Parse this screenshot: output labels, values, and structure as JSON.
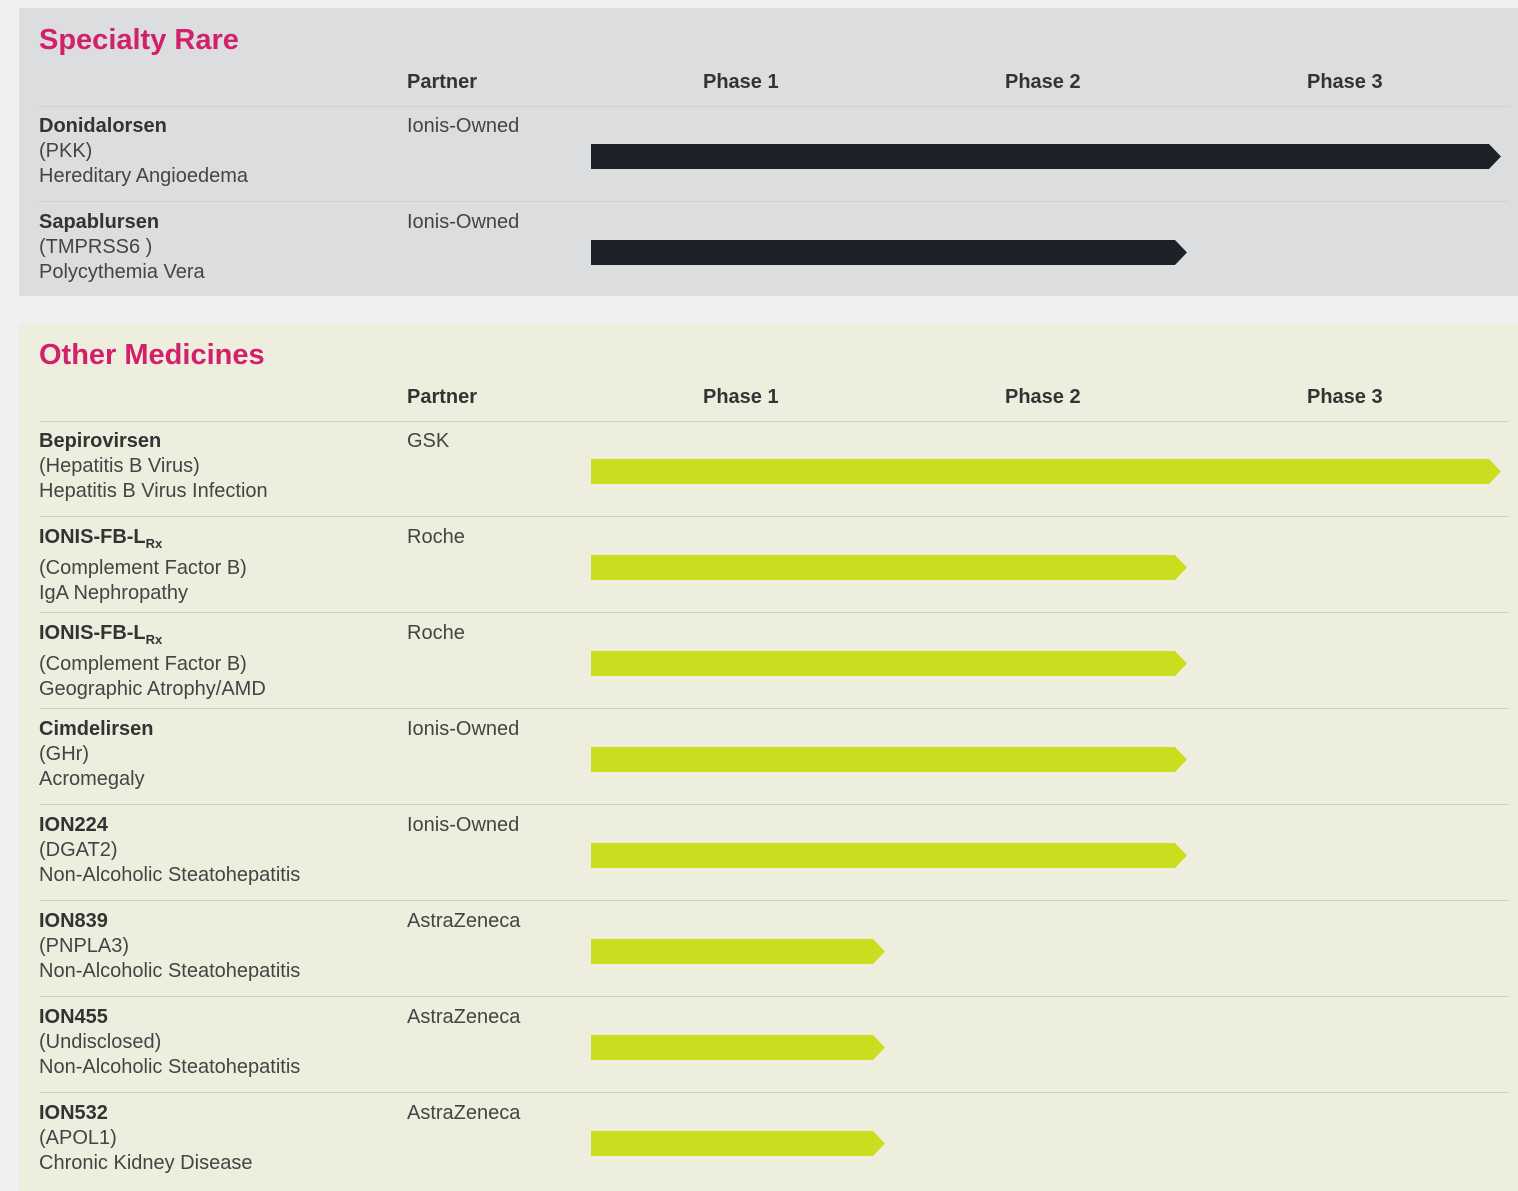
{
  "colors": {
    "title": "#d2206b",
    "rare_bar": "#1d2128",
    "other_bar": "#ccdc1f",
    "rare_bg": "#dcdddf",
    "other_bg": "#eeeedf"
  },
  "headers": {
    "partner": "Partner",
    "phase1": "Phase 1",
    "phase2": "Phase 2",
    "phase3": "Phase 3"
  },
  "specialty_rare": {
    "title": "Specialty Rare",
    "rows": [
      {
        "name": "Donidalorsen",
        "name_sub": "",
        "target": "(PKK)",
        "indication": "Hereditary Angioedema",
        "partner": "Ionis-Owned",
        "phase_reached": 3
      },
      {
        "name": "Sapablursen",
        "name_sub": "",
        "target": "(TMPRSS6 )",
        "indication": "Polycythemia Vera",
        "partner": "Ionis-Owned",
        "phase_reached": 2
      }
    ]
  },
  "other_medicines": {
    "title": "Other Medicines",
    "rows": [
      {
        "name": "Bepirovirsen",
        "name_sub": "",
        "target": "(Hepatitis B Virus)",
        "indication": "Hepatitis B Virus Infection",
        "partner": "GSK",
        "phase_reached": 3
      },
      {
        "name": "IONIS-FB-L",
        "name_sub": "Rx",
        "target": "(Complement Factor B)",
        "indication": "IgA Nephropathy",
        "partner": "Roche",
        "phase_reached": 2
      },
      {
        "name": "IONIS-FB-L",
        "name_sub": "Rx",
        "target": "(Complement Factor B)",
        "indication": "Geographic Atrophy/AMD",
        "partner": "Roche",
        "phase_reached": 2
      },
      {
        "name": "Cimdelirsen",
        "name_sub": "",
        "target": "(GHr)",
        "indication": "Acromegaly",
        "partner": "Ionis-Owned",
        "phase_reached": 2
      },
      {
        "name": "ION224",
        "name_sub": "",
        "target": "(DGAT2)",
        "indication": "Non-Alcoholic Steatohepatitis",
        "partner": "Ionis-Owned",
        "phase_reached": 2
      },
      {
        "name": "ION839",
        "name_sub": "",
        "target": "(PNPLA3)",
        "indication": "Non-Alcoholic Steatohepatitis",
        "partner": "AstraZeneca",
        "phase_reached": 1
      },
      {
        "name": "ION455",
        "name_sub": "",
        "target": "(Undisclosed)",
        "indication": "Non-Alcoholic Steatohepatitis",
        "partner": "AstraZeneca",
        "phase_reached": 1
      },
      {
        "name": "ION532",
        "name_sub": "",
        "target": "(APOL1)",
        "indication": "Chronic Kidney Disease",
        "partner": "AstraZeneca",
        "phase_reached": 1
      }
    ]
  }
}
